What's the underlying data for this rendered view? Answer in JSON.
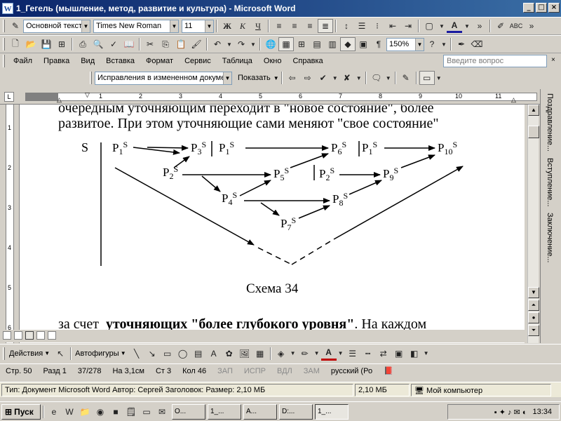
{
  "window": {
    "title": "1_Гегель (мышление, метод, развитие и культура) - Microsoft Word",
    "app_icon": "W",
    "controls": {
      "minimize": "_",
      "maximize": "□",
      "close": "×"
    }
  },
  "formatting": {
    "style": "Основной текст",
    "font": "Times New Roman",
    "size": "11",
    "bold": "Ж",
    "italic": "К",
    "underline": "Ч"
  },
  "standard": {
    "zoom": "150%"
  },
  "menu": {
    "items": [
      "Файл",
      "Правка",
      "Вид",
      "Вставка",
      "Формат",
      "Сервис",
      "Таблица",
      "Окно",
      "Справка"
    ],
    "ask_placeholder": "Введите вопрос"
  },
  "reviewing": {
    "mode": "Исправления в измененном документе",
    "show": "Показать"
  },
  "ruler": {
    "numbers": [
      "1",
      "2",
      "3",
      "4",
      "5",
      "6",
      "7",
      "8",
      "9",
      "10",
      "11"
    ],
    "vertical": [
      "1",
      "2",
      "3",
      "4",
      "5",
      "6"
    ]
  },
  "document": {
    "line1": "очередным уточняющим переходит в \"новое состояние\", более",
    "line2": "развитое. При этом уточняющие сами меняют \"свое состояние\"",
    "line3_a": "за счет",
    "line3_b": "уточняющих \"более глубокого уровня\"",
    "line3_c": ". На каждом",
    "caption": "Схема 34"
  },
  "diagram": {
    "root": "S",
    "sup": "S",
    "nodes": {
      "p1": "P",
      "p1_sub": "1",
      "p3": "P",
      "p3_sub": "3",
      "p1b": "P",
      "p1b_sub": "1",
      "p6": "P",
      "p6_sub": "6",
      "p1c": "P",
      "p1c_sub": "1",
      "p10": "P",
      "p10_sub": "10",
      "p2": "P",
      "p2_sub": "2",
      "p5": "P",
      "p5_sub": "5",
      "p2b": "P",
      "p2b_sub": "2",
      "p9": "P",
      "p9_sub": "9",
      "p4": "P",
      "p4_sub": "4",
      "p8": "P",
      "p8_sub": "8",
      "p7": "P",
      "p7_sub": "7"
    }
  },
  "docmap": {
    "items": [
      "Поздравление...",
      "Вступление...",
      "Заключение..."
    ]
  },
  "drawing": {
    "actions": "Действия",
    "autoshapes": "Автофигуры"
  },
  "status": {
    "page": "Стр. 50",
    "section": "Разд 1",
    "pages": "37/278",
    "at": "На 3,1см",
    "line": "Ст 3",
    "col": "Кол 46",
    "rec": "ЗАП",
    "trk": "ИСПР",
    "ext": "ВДЛ",
    "ovr": "ЗАМ",
    "lang": "русский (Ро"
  },
  "tooltip": {
    "info": "Тип: Документ Microsoft Word Автор: Сергей Заголовок: Размер: 2,10 МБ",
    "size": "2,10 МБ",
    "location": "Мой компьютер"
  },
  "taskbar": {
    "start": "Пуск",
    "tasks": [
      "О...",
      "1_...",
      "А...",
      "D:...",
      "1_..."
    ],
    "clock": "13:34"
  }
}
